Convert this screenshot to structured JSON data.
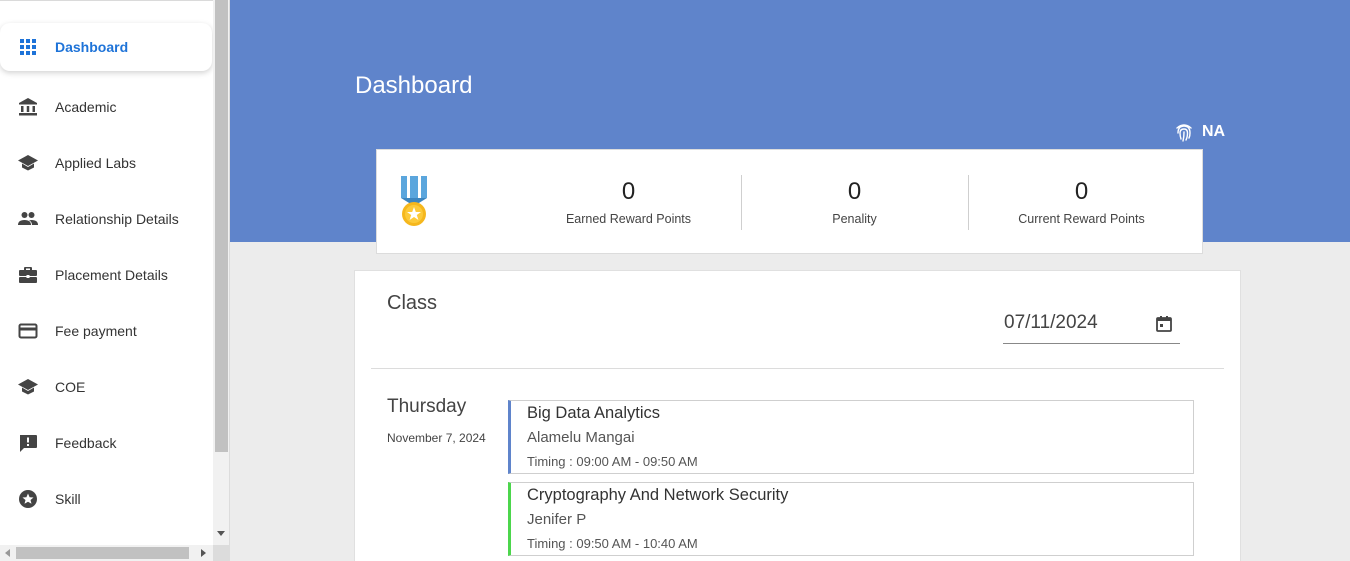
{
  "sidebar": {
    "items": [
      {
        "label": "Dashboard",
        "icon": "grid-icon",
        "active": true
      },
      {
        "label": "Academic",
        "icon": "institution-icon",
        "active": false
      },
      {
        "label": "Applied Labs",
        "icon": "graduation-cap-icon",
        "active": false
      },
      {
        "label": "Relationship Details",
        "icon": "people-icon",
        "active": false
      },
      {
        "label": "Placement Details",
        "icon": "briefcase-icon",
        "active": false
      },
      {
        "label": "Fee payment",
        "icon": "credit-card-icon",
        "active": false
      },
      {
        "label": "COE",
        "icon": "graduation-cap-icon",
        "active": false
      },
      {
        "label": "Feedback",
        "icon": "feedback-icon",
        "active": false
      },
      {
        "label": "Skill",
        "icon": "star-circle-icon",
        "active": false
      }
    ]
  },
  "header": {
    "title": "Dashboard",
    "user_label": "NA",
    "user_icon": "fingerprint-icon"
  },
  "rewards": {
    "icon": "medal-icon",
    "earned_value": "0",
    "earned_label": "Earned Reward Points",
    "penalty_value": "0",
    "penalty_label": "Penality",
    "current_value": "0",
    "current_label": "Current Reward Points"
  },
  "class": {
    "title": "Class",
    "date_value": "07/11/2024",
    "date_icon": "calendar-icon",
    "day_name": "Thursday",
    "day_date": "November 7, 2024",
    "sessions": [
      {
        "subject": "Big Data Analytics",
        "faculty": "Alamelu Mangai",
        "timing": "Timing : 09:00 AM - 09:50 AM",
        "accent": "#5f84cb"
      },
      {
        "subject": "Cryptography And Network Security",
        "faculty": "Jenifer P",
        "timing": "Timing : 09:50 AM - 10:40 AM",
        "accent": "#4cd64c"
      }
    ]
  },
  "colors": {
    "header_bg": "#5f84cb",
    "active_text": "#1e73d8"
  }
}
